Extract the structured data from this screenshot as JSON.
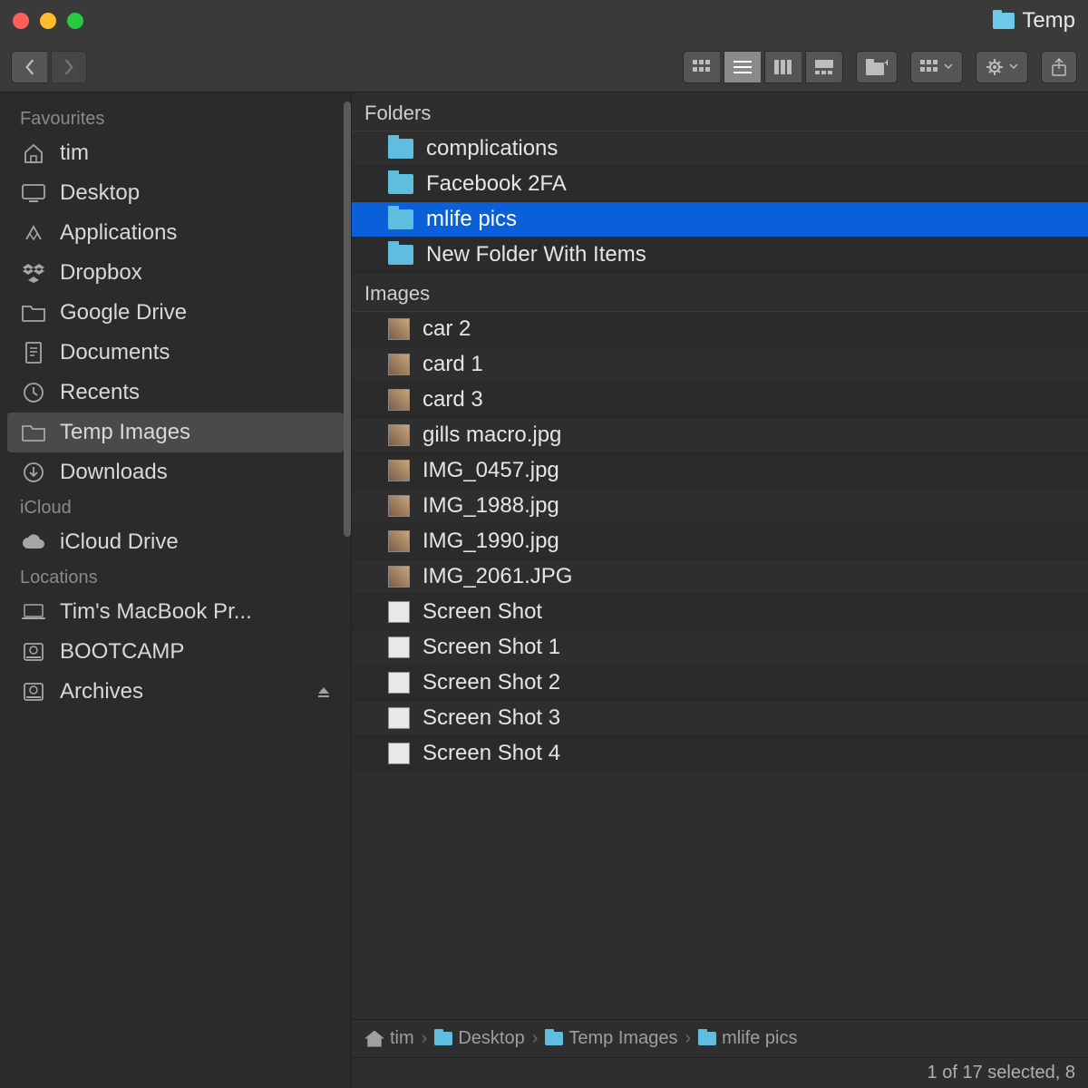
{
  "title": "Temp",
  "toolbar": {
    "view_modes": [
      "icon",
      "list",
      "column",
      "gallery"
    ],
    "active_view": "list"
  },
  "sidebar": {
    "sections": [
      {
        "title": "Favourites",
        "items": [
          {
            "icon": "home",
            "label": "tim"
          },
          {
            "icon": "desktop",
            "label": "Desktop"
          },
          {
            "icon": "apps",
            "label": "Applications"
          },
          {
            "icon": "dropbox",
            "label": "Dropbox"
          },
          {
            "icon": "folder",
            "label": "Google Drive"
          },
          {
            "icon": "documents",
            "label": "Documents"
          },
          {
            "icon": "recents",
            "label": "Recents"
          },
          {
            "icon": "folder",
            "label": "Temp Images",
            "selected": true
          },
          {
            "icon": "downloads",
            "label": "Downloads"
          }
        ]
      },
      {
        "title": "iCloud",
        "items": [
          {
            "icon": "cloud",
            "label": "iCloud Drive"
          }
        ]
      },
      {
        "title": "Locations",
        "items": [
          {
            "icon": "laptop",
            "label": "Tim's MacBook Pr..."
          },
          {
            "icon": "disk",
            "label": "BOOTCAMP"
          },
          {
            "icon": "disk",
            "label": "Archives",
            "eject": true
          }
        ]
      }
    ]
  },
  "content": {
    "groups": [
      {
        "header": "Folders",
        "rows": [
          {
            "type": "folder",
            "name": "complications"
          },
          {
            "type": "folder",
            "name": "Facebook 2FA"
          },
          {
            "type": "folder",
            "name": "mlife pics",
            "selected": true
          },
          {
            "type": "folder",
            "name": "New Folder With Items"
          }
        ]
      },
      {
        "header": "Images",
        "rows": [
          {
            "type": "image",
            "name": "car 2"
          },
          {
            "type": "image",
            "name": "card 1"
          },
          {
            "type": "image",
            "name": "card 3"
          },
          {
            "type": "image",
            "name": "gills macro.jpg"
          },
          {
            "type": "image",
            "name": "IMG_0457.jpg"
          },
          {
            "type": "image",
            "name": "IMG_1988.jpg"
          },
          {
            "type": "image",
            "name": "IMG_1990.jpg"
          },
          {
            "type": "image",
            "name": "IMG_2061.JPG"
          },
          {
            "type": "blank",
            "name": "Screen Shot"
          },
          {
            "type": "blank",
            "name": "Screen Shot 1"
          },
          {
            "type": "blank",
            "name": "Screen Shot 2"
          },
          {
            "type": "blank",
            "name": "Screen Shot 3"
          },
          {
            "type": "blank",
            "name": "Screen Shot 4"
          }
        ]
      }
    ]
  },
  "pathbar": [
    {
      "icon": "home",
      "label": "tim"
    },
    {
      "icon": "folder",
      "label": "Desktop"
    },
    {
      "icon": "folder",
      "label": "Temp Images"
    },
    {
      "icon": "folder",
      "label": "mlife pics"
    }
  ],
  "status": "1 of 17 selected, 8"
}
